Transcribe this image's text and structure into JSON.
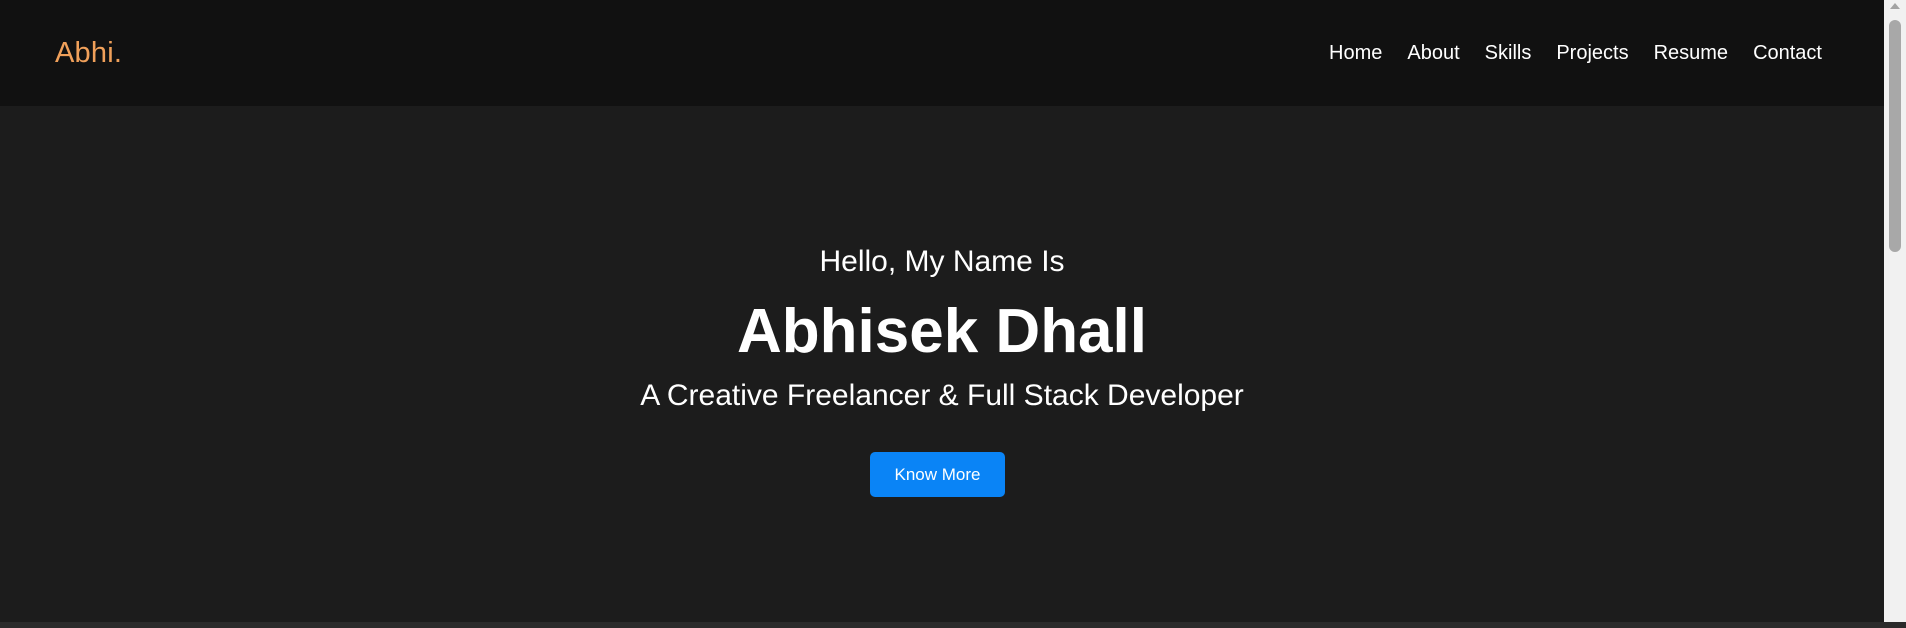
{
  "brand": {
    "name": "Abhi.",
    "color": "#f0a05a"
  },
  "nav": {
    "items": [
      {
        "label": "Home"
      },
      {
        "label": "About"
      },
      {
        "label": "Skills"
      },
      {
        "label": "Projects"
      },
      {
        "label": "Resume"
      },
      {
        "label": "Contact"
      }
    ]
  },
  "hero": {
    "greeting": "Hello, My Name Is",
    "name": "Abhisek Dhall",
    "tagline": "A Creative Freelancer & Full Stack Developer",
    "cta_label": "Know More",
    "cta_color": "#0a84f6"
  },
  "theme": {
    "nav_background": "#111111",
    "page_background": "#1c1c1c",
    "text_color": "#ffffff"
  }
}
